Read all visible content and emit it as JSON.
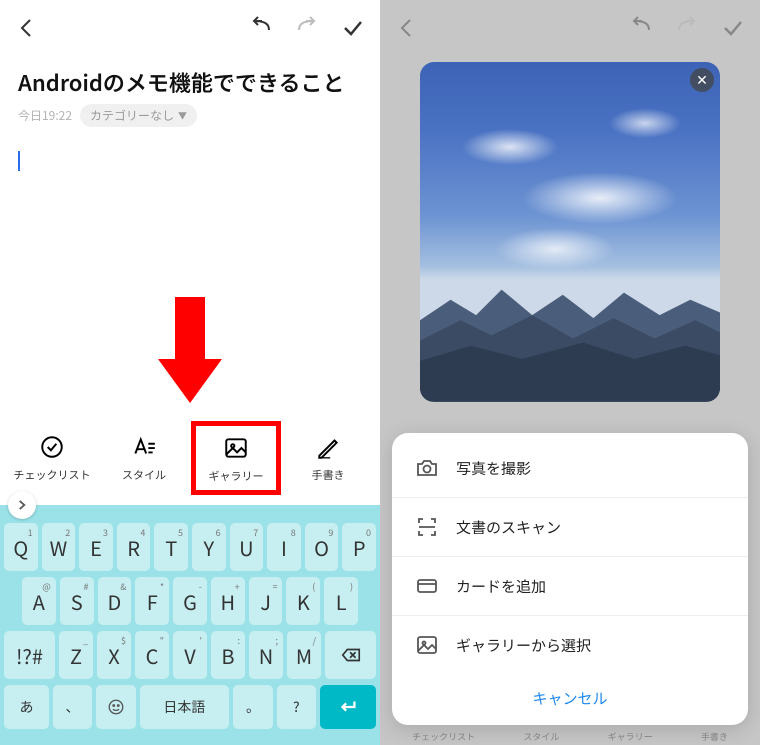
{
  "left": {
    "title": "Androidのメモ機能でできること",
    "timestamp": "今日19:22",
    "category": "カテゴリーなし",
    "toolbar": {
      "checklist": "チェックリスト",
      "style": "スタイル",
      "gallery": "ギャラリー",
      "handwriting": "手書き"
    },
    "keyboard": {
      "row1": [
        {
          "k": "Q",
          "s": "1"
        },
        {
          "k": "W",
          "s": "2"
        },
        {
          "k": "E",
          "s": "3"
        },
        {
          "k": "R",
          "s": "4"
        },
        {
          "k": "T",
          "s": "5"
        },
        {
          "k": "Y",
          "s": "6"
        },
        {
          "k": "U",
          "s": "7"
        },
        {
          "k": "I",
          "s": "8"
        },
        {
          "k": "O",
          "s": "9"
        },
        {
          "k": "P",
          "s": "0"
        }
      ],
      "row2": [
        {
          "k": "A",
          "s": "@"
        },
        {
          "k": "S",
          "s": "#"
        },
        {
          "k": "D",
          "s": "&"
        },
        {
          "k": "F",
          "s": "*"
        },
        {
          "k": "G",
          "s": "-"
        },
        {
          "k": "H",
          "s": "+"
        },
        {
          "k": "J",
          "s": "="
        },
        {
          "k": "K",
          "s": "("
        },
        {
          "k": "L",
          "s": ")"
        }
      ],
      "row3": [
        {
          "k": "Z",
          "s": "_"
        },
        {
          "k": "X",
          "s": "$"
        },
        {
          "k": "C",
          "s": "\""
        },
        {
          "k": "V",
          "s": "'"
        },
        {
          "k": "B",
          "s": ":"
        },
        {
          "k": "N",
          "s": ";"
        },
        {
          "k": "M",
          "s": "/"
        }
      ],
      "sym": "!?#",
      "lang": "日本語",
      "mode": "あ"
    }
  },
  "right": {
    "sheet": {
      "camera": "写真を撮影",
      "scan": "文書のスキャン",
      "card": "カードを追加",
      "gallery": "ギャラリーから選択",
      "cancel": "キャンセル"
    },
    "bg_toolbar": {
      "checklist": "チェックリスト",
      "style": "スタイル",
      "gallery": "ギャラリー",
      "handwriting": "手書き"
    }
  }
}
